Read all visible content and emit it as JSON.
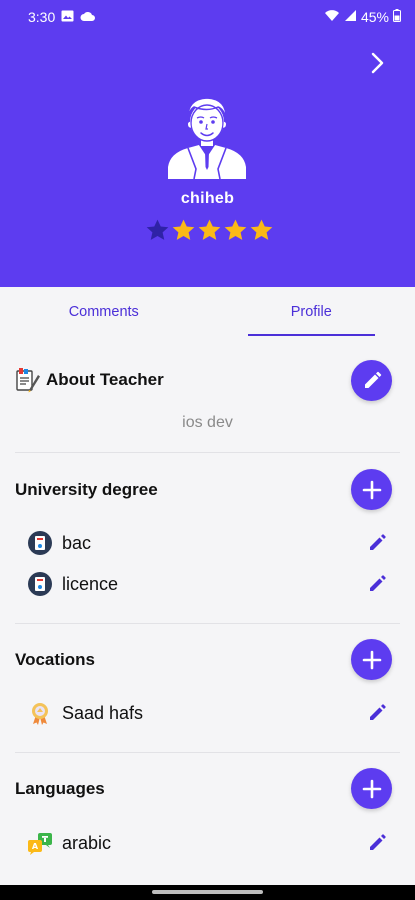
{
  "status_bar": {
    "time": "3:30",
    "battery": "45%"
  },
  "profile": {
    "name": "chiheb",
    "rating": 4,
    "rating_max": 5
  },
  "tabs": [
    {
      "label": "Comments",
      "active": false
    },
    {
      "label": "Profile",
      "active": true
    }
  ],
  "about": {
    "title": "About Teacher",
    "text": "ios dev"
  },
  "degrees": {
    "title": "University degree",
    "items": [
      {
        "label": "bac",
        "icon": "certificate-icon"
      },
      {
        "label": "licence",
        "icon": "certificate-icon"
      }
    ]
  },
  "vocations": {
    "title": "Vocations",
    "items": [
      {
        "label": "Saad hafs",
        "icon": "award-ribbon-icon"
      }
    ]
  },
  "languages": {
    "title": "Languages",
    "items": [
      {
        "label": "arabic",
        "icon": "translate-icon"
      }
    ]
  },
  "colors": {
    "primary": "#5d3cf0",
    "star_filled": "#fbb917",
    "star_empty": "#2f22a6"
  }
}
